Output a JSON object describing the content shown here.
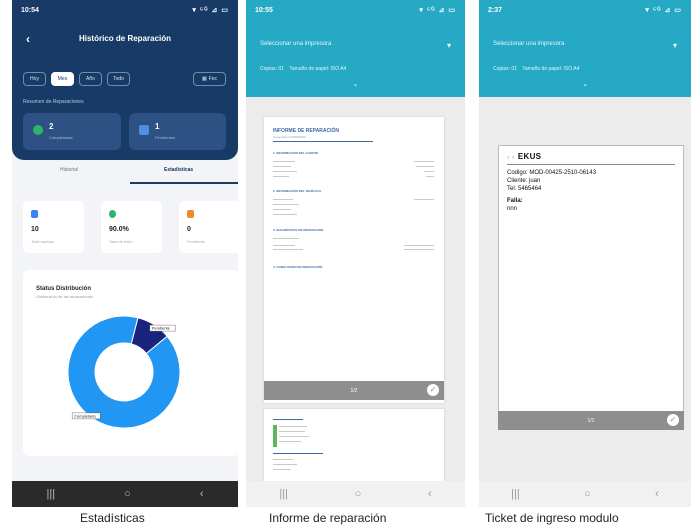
{
  "phone1": {
    "status": {
      "time": "10:54",
      "icons": "▾ ⁵ᴳ ⊿ ▭"
    },
    "title": "Histórico de Reparación",
    "filters": [
      "Hoy",
      "Mes",
      "Año",
      "Todo"
    ],
    "active_filter": "Mes",
    "date_button": "Fec",
    "section_label": "Resumen de Reparaciones",
    "summary_cards": [
      {
        "value": "2",
        "label": "Completadas",
        "color": "#2fb36a"
      },
      {
        "value": "1",
        "label": "Pendientes",
        "color": "#4d8fe0"
      }
    ],
    "tabs": [
      "Historial",
      "Estadísticas"
    ],
    "active_tab": "Estadísticas",
    "metrics": [
      {
        "value": "10",
        "label": "Total reparac.",
        "color": "#3b82f6"
      },
      {
        "value": "90.0%",
        "label": "Tasa de éxito",
        "color": "#2fb36a"
      },
      {
        "value": "0",
        "label": "Pendiente",
        "color": "#f08a2b"
      }
    ],
    "chart_title": "Status Distribución",
    "chart_subtitle": "Distribución de las reparaciones",
    "chart_data": {
      "type": "pie",
      "categories": [
        "Completado",
        "Pendiente"
      ],
      "values": [
        90,
        10
      ],
      "colors": [
        "#2196f3",
        "#1a237e"
      ],
      "title": "Status Distribución"
    }
  },
  "phone2": {
    "status": {
      "time": "10:55"
    },
    "printer_select": "Seleccionar una impresora",
    "copies_label": "Copias: 01",
    "paper_label": "Tamaño de papel: ISO A4",
    "doc_title": "INFORME DE REPARACIÓN",
    "doc_subtitle": "Generado el 00/00/0000",
    "sections": [
      "1. INFORMACIÓN DEL CLIENTE",
      "2. INFORMACIÓN DEL VEHÍCULO",
      "3. DIAGNÓSTICO DE REPARACIÓN",
      "4. CONCLUSIÓN DE REPARACIÓN"
    ],
    "page_number": "1/2"
  },
  "phone3": {
    "status": {
      "time": "2:37"
    },
    "printer_select": "Seleccionar una impresora",
    "copies_label": "Copias: 01",
    "paper_label": "Tamaño de papel: ISO A4",
    "brand": "EKUS",
    "codigo": "Codigo: MOD-00425-2510-06143",
    "cliente": "Cliente: juan",
    "tel": "Tel: 5465464",
    "falla_label": "Falla:",
    "falla_value": "nnn",
    "page_number": "1/1"
  },
  "captions": [
    "Estadísticas",
    "Informe de reparación",
    "Ticket de ingreso modulo"
  ]
}
